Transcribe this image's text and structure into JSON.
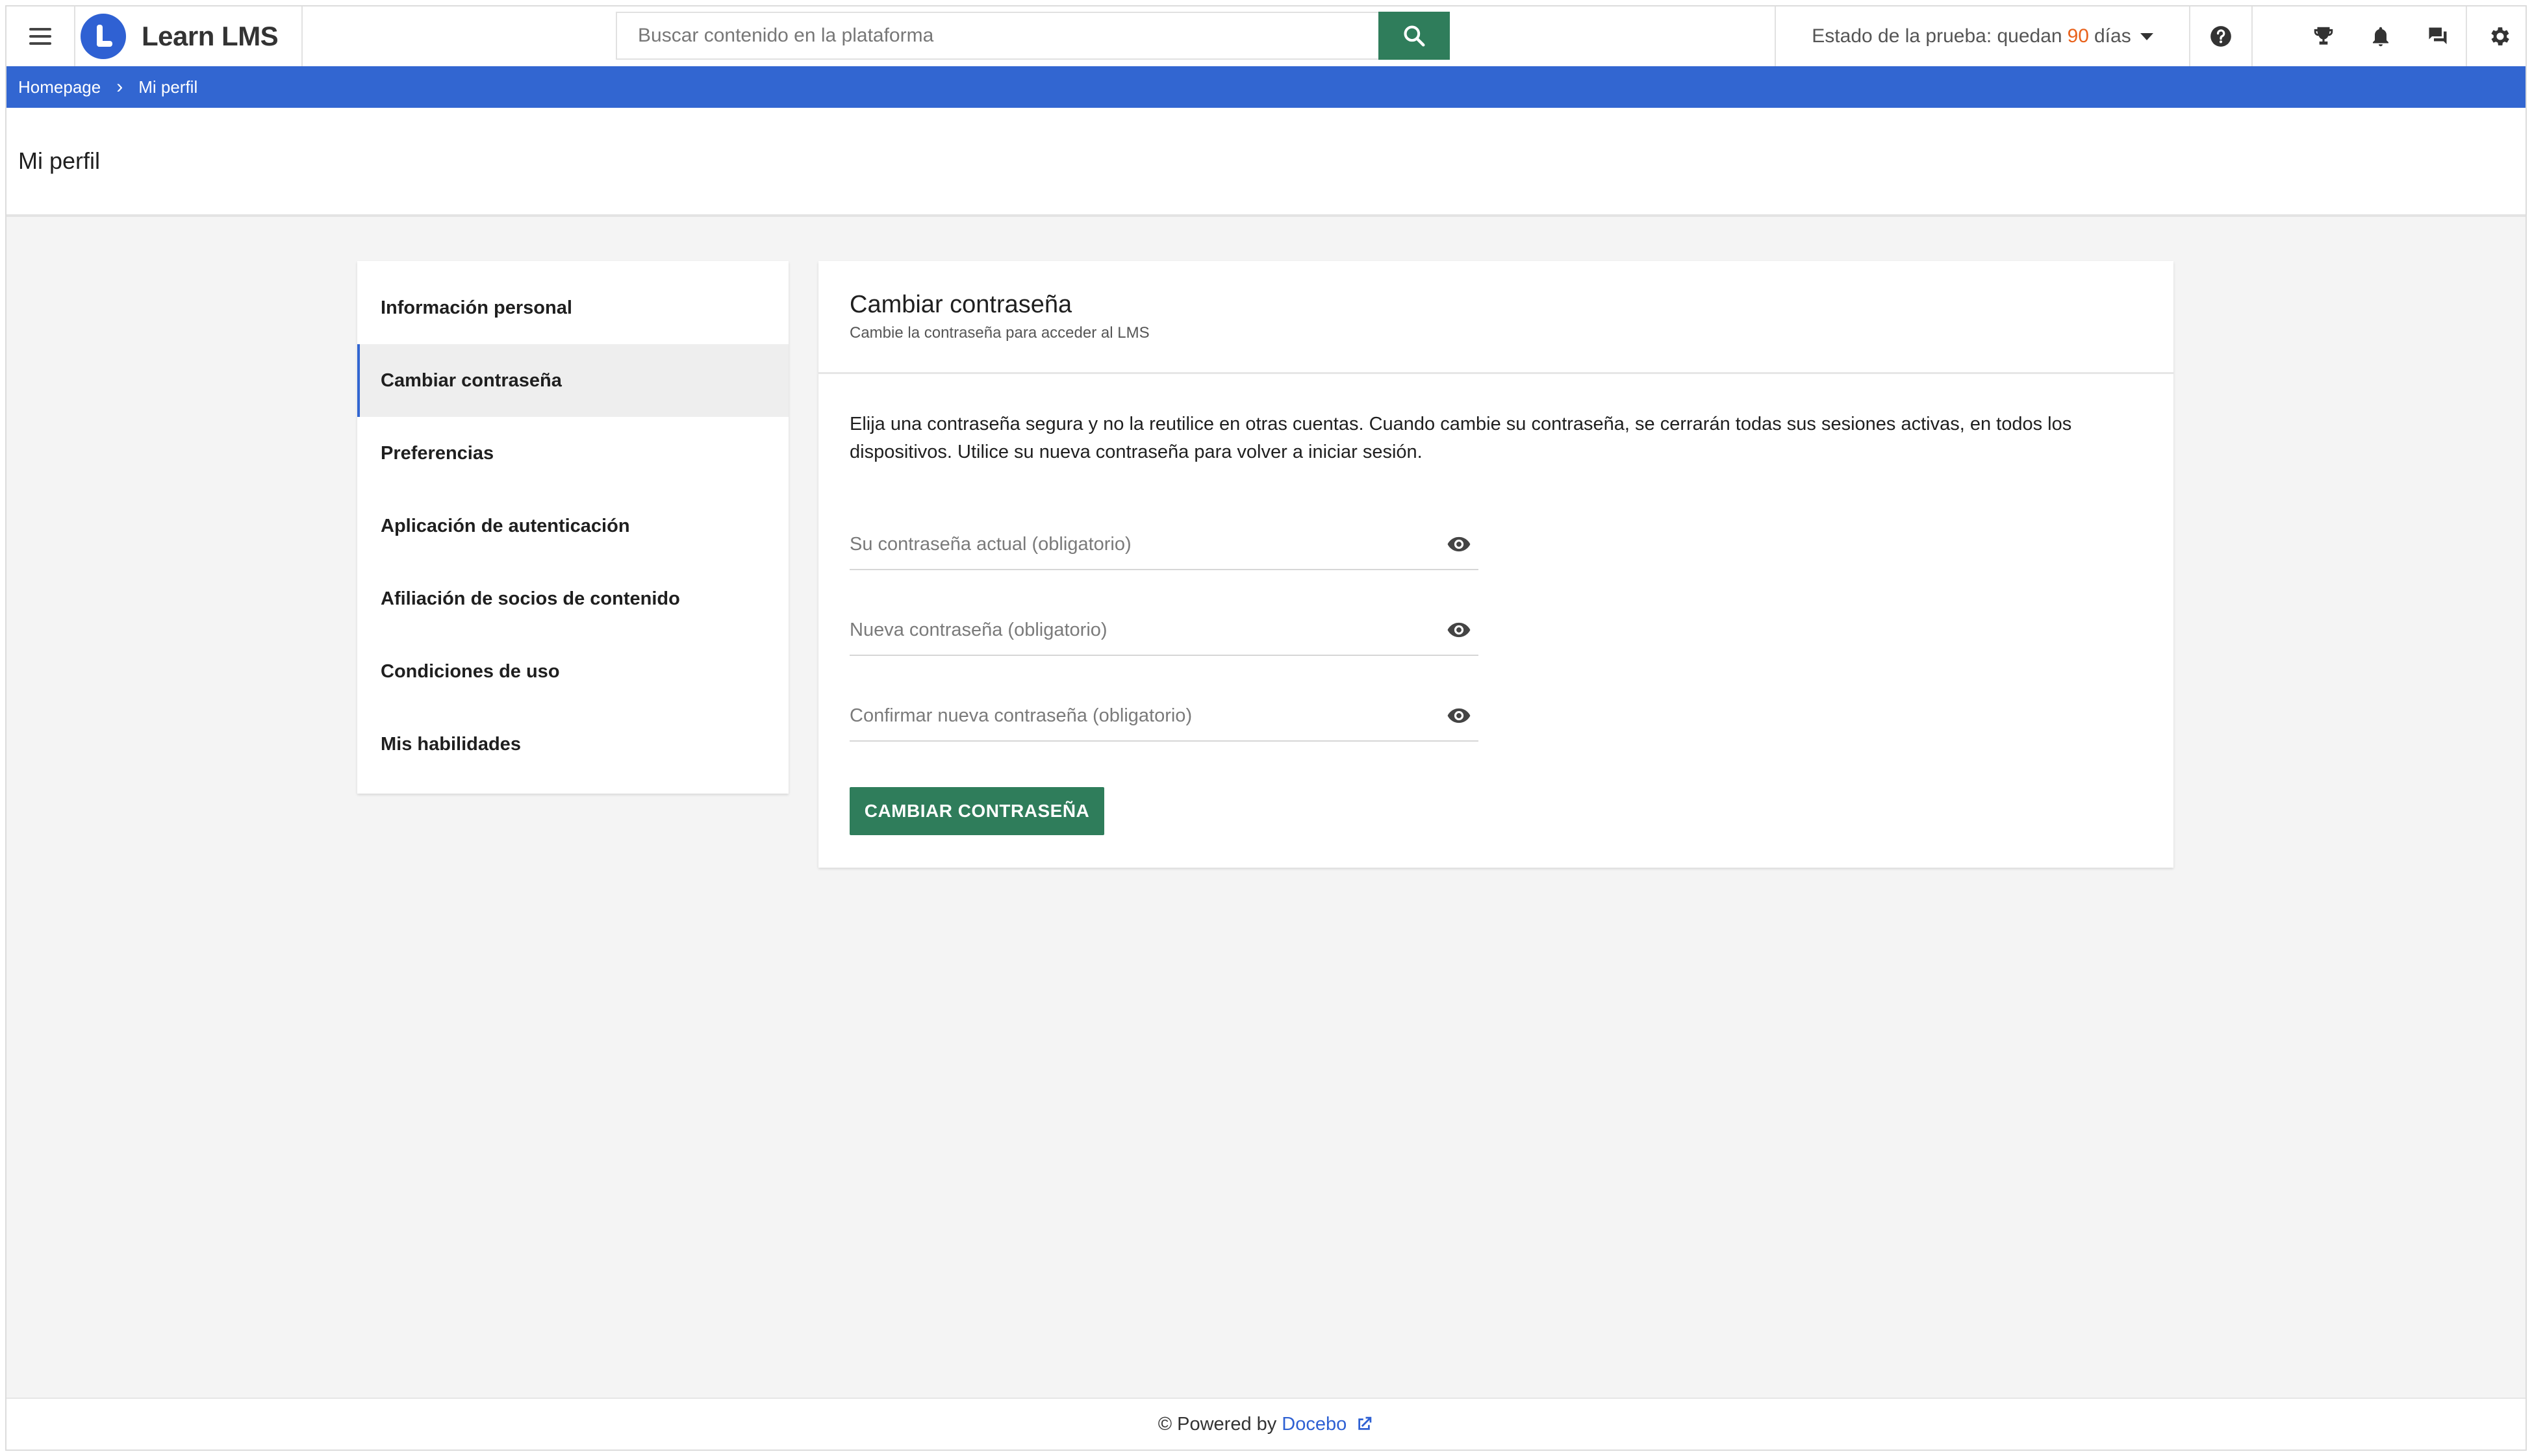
{
  "app": {
    "name": "Learn LMS"
  },
  "search": {
    "placeholder": "Buscar contenido en la plataforma",
    "value": ""
  },
  "trial": {
    "prefix": "Estado de la prueba: quedan",
    "days": "90",
    "suffix": "días"
  },
  "top_icons": [
    "help-icon",
    "trophy-icon",
    "bell-icon",
    "chat-icon",
    "gear-icon"
  ],
  "breadcrumb": {
    "home": "Homepage",
    "separator": "›",
    "current": "Mi perfil"
  },
  "page": {
    "title": "Mi perfil"
  },
  "side_menu": {
    "items": [
      {
        "label": "Información personal",
        "active": false
      },
      {
        "label": "Cambiar contraseña",
        "active": true
      },
      {
        "label": "Preferencias",
        "active": false
      },
      {
        "label": "Aplicación de autenticación",
        "active": false
      },
      {
        "label": "Afiliación de socios de contenido",
        "active": false
      },
      {
        "label": "Condiciones de uso",
        "active": false
      },
      {
        "label": "Mis habilidades",
        "active": false
      }
    ]
  },
  "card": {
    "title": "Cambiar contraseña",
    "subtitle": "Cambie la contraseña para acceder al LMS",
    "description": "Elija una contraseña segura y no la reutilice en otras cuentas. Cuando cambie su contraseña, se cerrarán todas sus sesiones activas, en todos los dispositivos. Utilice su nueva contraseña para volver a iniciar sesión.",
    "fields": [
      {
        "placeholder": "Su contraseña actual (obligatorio)",
        "value": ""
      },
      {
        "placeholder": "Nueva contraseña (obligatorio)",
        "value": ""
      },
      {
        "placeholder": "Confirmar nueva contraseña (obligatorio)",
        "value": ""
      }
    ],
    "submit_label": "CAMBIAR CONTRASEÑA"
  },
  "footer": {
    "powered_by": "© Powered by",
    "link_label": "Docebo"
  },
  "colors": {
    "accent_blue": "#3266d1",
    "button_green": "#2f7d5b",
    "trial_days_orange": "#e8621c"
  }
}
